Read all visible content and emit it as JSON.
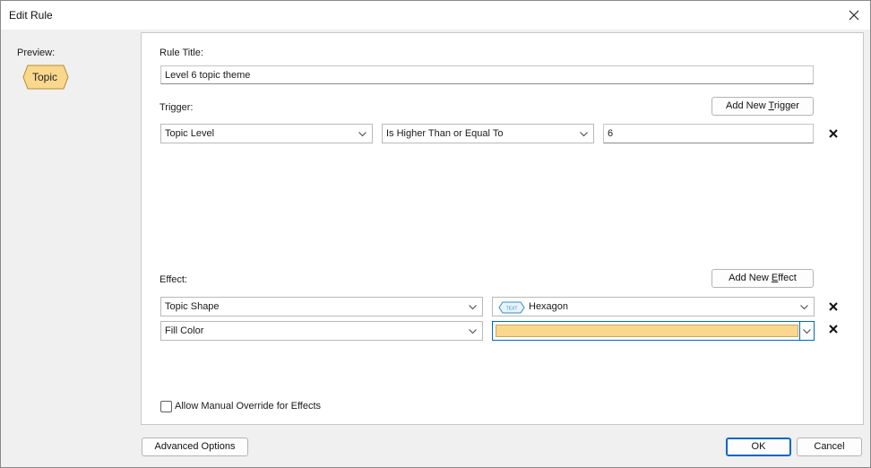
{
  "window": {
    "title": "Edit Rule"
  },
  "preview": {
    "label": "Preview:",
    "topic_text": "Topic",
    "topic_fill": "#f9d88e",
    "topic_stroke": "#b58b2a"
  },
  "rule_title": {
    "label": "Rule Title:",
    "value": "Level 6 topic theme"
  },
  "trigger": {
    "label": "Trigger:",
    "add_button": "Add New Trigger",
    "rows": [
      {
        "property": "Topic Level",
        "operator": "Is Higher Than or Equal To",
        "value": "6"
      }
    ]
  },
  "effect": {
    "label": "Effect:",
    "add_button": "Add New Effect",
    "rows": [
      {
        "property": "Topic Shape",
        "value": "Hexagon",
        "badge_text": "TEXT"
      },
      {
        "property": "Fill Color",
        "color": "#f9d88e"
      }
    ]
  },
  "allow_override": {
    "label": "Allow Manual Override for Effects",
    "checked": false
  },
  "footer": {
    "advanced": "Advanced Options",
    "ok": "OK",
    "cancel": "Cancel"
  },
  "colors": {
    "accent": "#0067c0",
    "fill_color": "#f9d88e"
  }
}
